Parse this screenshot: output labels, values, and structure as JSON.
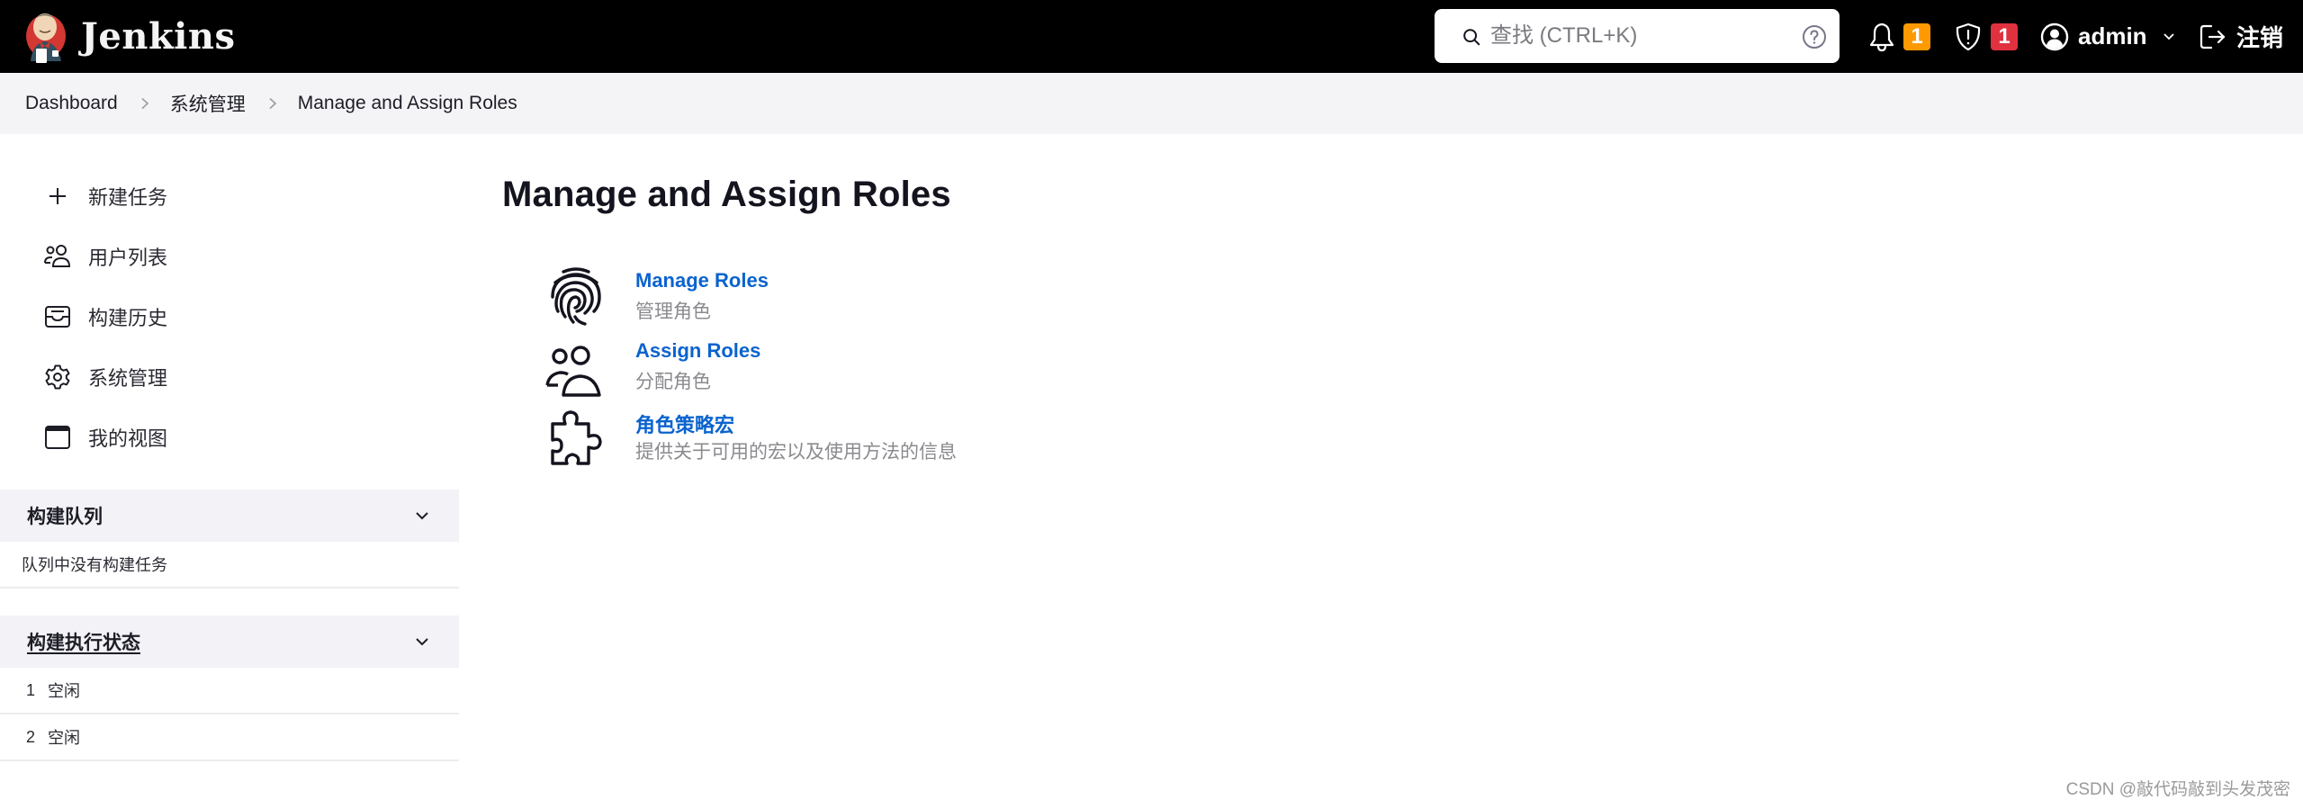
{
  "header": {
    "app_name": "Jenkins",
    "search": {
      "placeholder": "查找 (CTRL+K)",
      "value": ""
    },
    "notifications": {
      "icon": "bell-icon",
      "count": "1",
      "badge_color": "#fe9a00"
    },
    "security_alerts": {
      "icon": "shield-alert-icon",
      "count": "1",
      "badge_color": "#e0313f"
    },
    "user": {
      "icon": "user-circle-icon",
      "name": "admin"
    },
    "logout": {
      "icon": "logout-icon",
      "label": "注销"
    }
  },
  "breadcrumb": [
    {
      "label": "Dashboard"
    },
    {
      "label": "系统管理"
    },
    {
      "label": "Manage and Assign Roles"
    }
  ],
  "sidebar": {
    "tasks": [
      {
        "label": "新建任务",
        "icon": "plus-icon"
      },
      {
        "label": "用户列表",
        "icon": "people-icon"
      },
      {
        "label": "构建历史",
        "icon": "inbox-icon"
      },
      {
        "label": "系统管理",
        "icon": "gear-icon"
      },
      {
        "label": "我的视图",
        "icon": "window-icon"
      }
    ],
    "build_queue": {
      "title": "构建队列",
      "empty_text": "队列中没有构建任务"
    },
    "executors": {
      "title": "构建执行状态",
      "rows": [
        {
          "number": "1",
          "status": "空闲"
        },
        {
          "number": "2",
          "status": "空闲"
        }
      ]
    }
  },
  "main": {
    "title": "Manage and Assign Roles",
    "items": [
      {
        "label": "Manage Roles",
        "description": "管理角色",
        "icon": "fingerprint-icon"
      },
      {
        "label": "Assign Roles",
        "description": "分配角色",
        "icon": "people-icon"
      },
      {
        "label": "角色策略宏",
        "description": "提供关于可用的宏以及使用方法的信息",
        "icon": "puzzle-icon"
      }
    ]
  },
  "colors": {
    "header_bg": "#000000",
    "link": "#0b63ce",
    "breadcrumb_bg": "#f4f4f6",
    "pane_header_bg": "#f2f2f7"
  },
  "watermark": "CSDN @敲代码敲到头发茂密"
}
